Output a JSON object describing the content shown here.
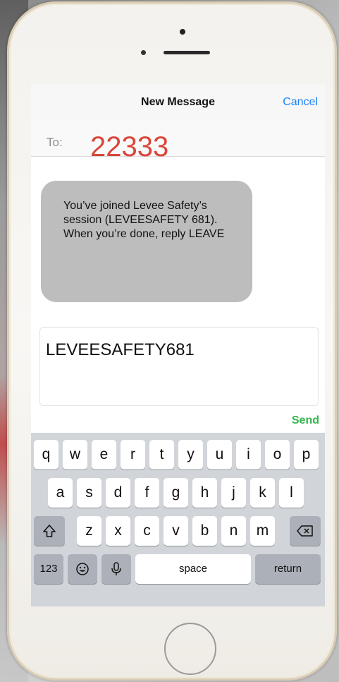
{
  "nav": {
    "title": "New Message",
    "cancel": "Cancel"
  },
  "recipient": {
    "label": "To:",
    "number": "22333"
  },
  "bubble": {
    "text": "You’ve joined Levee Safety’s session (LEVEESAFETY 681). When you’re done, reply LEAVE"
  },
  "compose": {
    "value": "LEVEESAFETY681"
  },
  "send_label": "Send",
  "keyboard": {
    "row1": [
      "q",
      "w",
      "e",
      "r",
      "t",
      "y",
      "u",
      "i",
      "o",
      "p"
    ],
    "row2": [
      "a",
      "s",
      "d",
      "f",
      "g",
      "h",
      "j",
      "k",
      "l"
    ],
    "row3": [
      "z",
      "x",
      "c",
      "v",
      "b",
      "n",
      "m"
    ],
    "numbers": "123",
    "space": "space",
    "return": "return"
  },
  "colors": {
    "number": "#d9453a",
    "cancel": "#1a82fb",
    "send": "#2fb64a",
    "bubble": "#bdbdbd",
    "keyboard": "#d1d4d9"
  }
}
